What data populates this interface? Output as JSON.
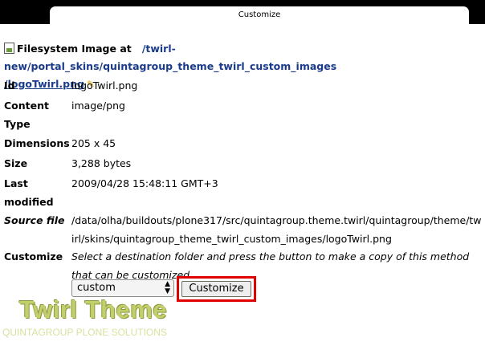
{
  "window": {
    "title": "Customize"
  },
  "breadcrumb": {
    "prefix": "Filesystem Image at",
    "path_parts": [
      "/twirl-new",
      "/portal_skins",
      "/quintagroup_theme_twirl_custom_images",
      "/logoTwirl.png"
    ],
    "pencil_icon": "pencil-icon"
  },
  "fields": {
    "id": {
      "label": "Id",
      "value": "logoTwirl.png"
    },
    "content_type": {
      "label": "Content Type",
      "value": "image/png"
    },
    "dimensions": {
      "label": "Dimensions",
      "value": "205 x 45"
    },
    "size": {
      "label": "Size",
      "value": "3,288 bytes"
    },
    "last_modified": {
      "label": "Last modified",
      "value": "2009/04/28 15:48:11 GMT+3"
    },
    "source_file": {
      "label": "Source file",
      "value": "/data/olha/buildouts/plone317/src/quintagroup.theme.twirl/quintagroup/theme/twirl/skins/quintagroup_theme_twirl_custom_images/logoTwirl.png"
    },
    "customize": {
      "label": "Customize",
      "instructions": "Select a destination folder and press the button to make a copy of this method that can be customized."
    }
  },
  "controls": {
    "folder_select": {
      "selected": "custom"
    },
    "customize_button": {
      "label": "Customize"
    }
  },
  "branding": {
    "logo_text": "Twirl Theme",
    "tagline": "QUINTAGROUP PLONE SOLUTIONS"
  }
}
